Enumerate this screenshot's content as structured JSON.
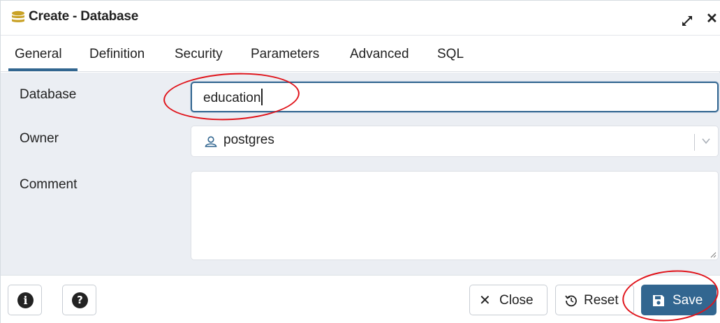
{
  "window": {
    "title": "Create - Database",
    "icons": {
      "app": "database-icon",
      "expand": "expand-icon",
      "close": "close-icon"
    }
  },
  "tabs": [
    {
      "label": "General",
      "active": true
    },
    {
      "label": "Definition",
      "active": false
    },
    {
      "label": "Security",
      "active": false
    },
    {
      "label": "Parameters",
      "active": false
    },
    {
      "label": "Advanced",
      "active": false
    },
    {
      "label": "SQL",
      "active": false
    }
  ],
  "form": {
    "database": {
      "label": "Database",
      "value": "education"
    },
    "owner": {
      "label": "Owner",
      "value": "postgres",
      "icon": "user-icon"
    },
    "comment": {
      "label": "Comment",
      "value": ""
    }
  },
  "footer": {
    "info_icon": "info-icon",
    "help_icon": "help-icon",
    "close_label": "Close",
    "reset_label": "Reset",
    "save_label": "Save"
  },
  "colors": {
    "accent": "#326690",
    "form_background": "#ebeef3",
    "annotation": "#e0131a"
  }
}
